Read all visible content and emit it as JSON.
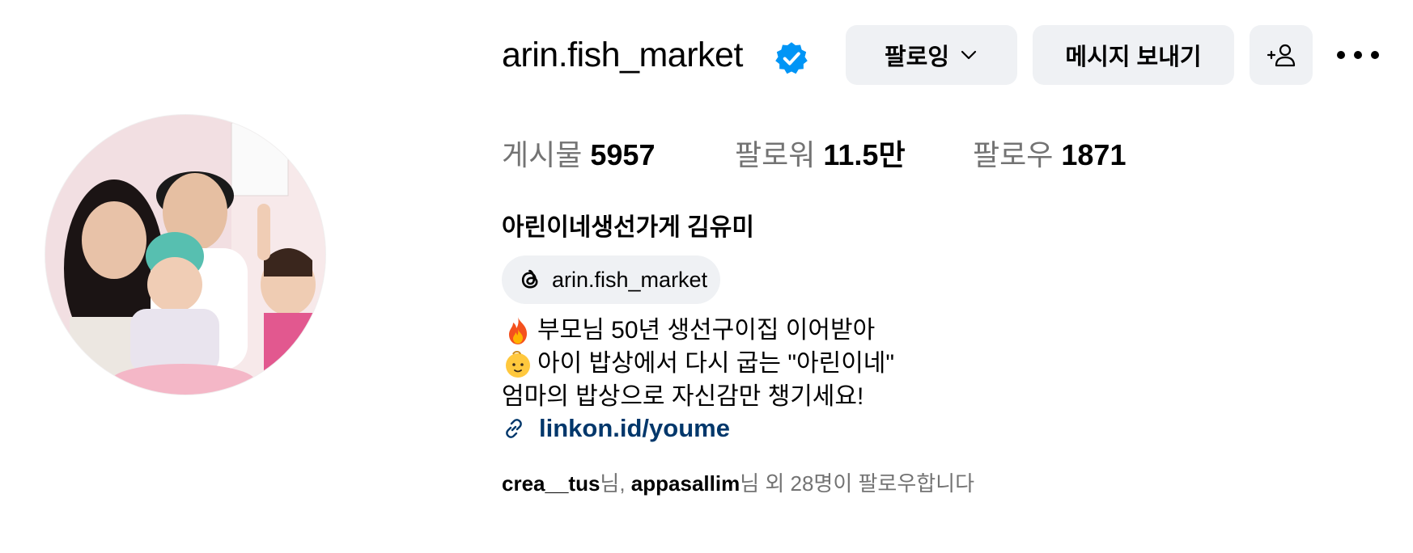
{
  "profile": {
    "username": "arin.fish_market",
    "verified": true,
    "avatar_alt": "family photo avatar"
  },
  "actions": {
    "following_label": "팔로잉",
    "message_label": "메시지 보내기",
    "add_user_icon": "add-person-icon",
    "more_icon": "more-options-icon"
  },
  "stats": {
    "posts_label": "게시물",
    "posts_value": "5957",
    "followers_label": "팔로워",
    "followers_value": "11.5만",
    "following_label": "팔로우",
    "following_value": "1871"
  },
  "bio": {
    "full_name": "아린이네생선가게 김유미",
    "threads_handle": "arin.fish_market",
    "lines": [
      {
        "emoji": "fire",
        "text": "부모님 50년 생선구이집 이어받아"
      },
      {
        "emoji": "baby",
        "text": "아이 밥상에서 다시 굽는 \"아린이네\""
      },
      {
        "emoji": "",
        "text": "엄마의 밥상으로 자신감만 챙기세요!"
      }
    ],
    "link": "linkon.id/youme"
  },
  "followed_by": {
    "user1": "crea__tus",
    "sep1": "님, ",
    "user2": "appasallim",
    "suffix": "님 외 28명이 팔로우합니다"
  },
  "colors": {
    "verified_blue": "#0095f6",
    "button_bg": "#eff1f4",
    "link_color": "#00376b",
    "secondary_text": "#737373"
  }
}
